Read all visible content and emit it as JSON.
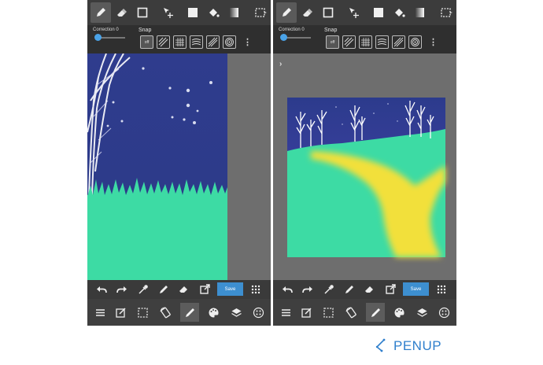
{
  "left_phone": {
    "options": {
      "correction": "Correction 0",
      "snap": "Snap",
      "snap_off": "off"
    },
    "actions": {
      "save": "Save"
    }
  },
  "right_phone": {
    "options": {
      "correction": "Correction 0",
      "snap": "Snap",
      "snap_off": "off"
    },
    "actions": {
      "save": "Save"
    }
  },
  "logo": {
    "text": "PENUP"
  },
  "icons": {
    "top_tools": [
      "pencil-icon",
      "eraser-icon",
      "rectangle-icon",
      "move-icon",
      "fill-color-icon",
      "paint-bucket-icon",
      "gradient-icon",
      "selection-icon"
    ],
    "snap": [
      "snap-off-icon",
      "snap-parallel-icon",
      "snap-grid-icon",
      "snap-curve-icon",
      "snap-perspective-icon",
      "snap-concentric-icon",
      "more-options-icon"
    ],
    "actions": [
      "undo-icon",
      "redo-icon",
      "eyedropper-icon",
      "pen-icon",
      "eraser-icon",
      "export-icon",
      "grid-icon"
    ],
    "bottom": [
      "menu-icon",
      "edit-icon",
      "selection-icon",
      "rotate-icon",
      "brush-icon",
      "palette-icon",
      "layers-icon",
      "brush-settings-icon"
    ]
  },
  "colors": {
    "accent": "#3d8fd0",
    "sky": "#2c3b8c",
    "grass": "#3ddba4",
    "path": "#f2e03b",
    "brand": "#2f7fcc"
  }
}
